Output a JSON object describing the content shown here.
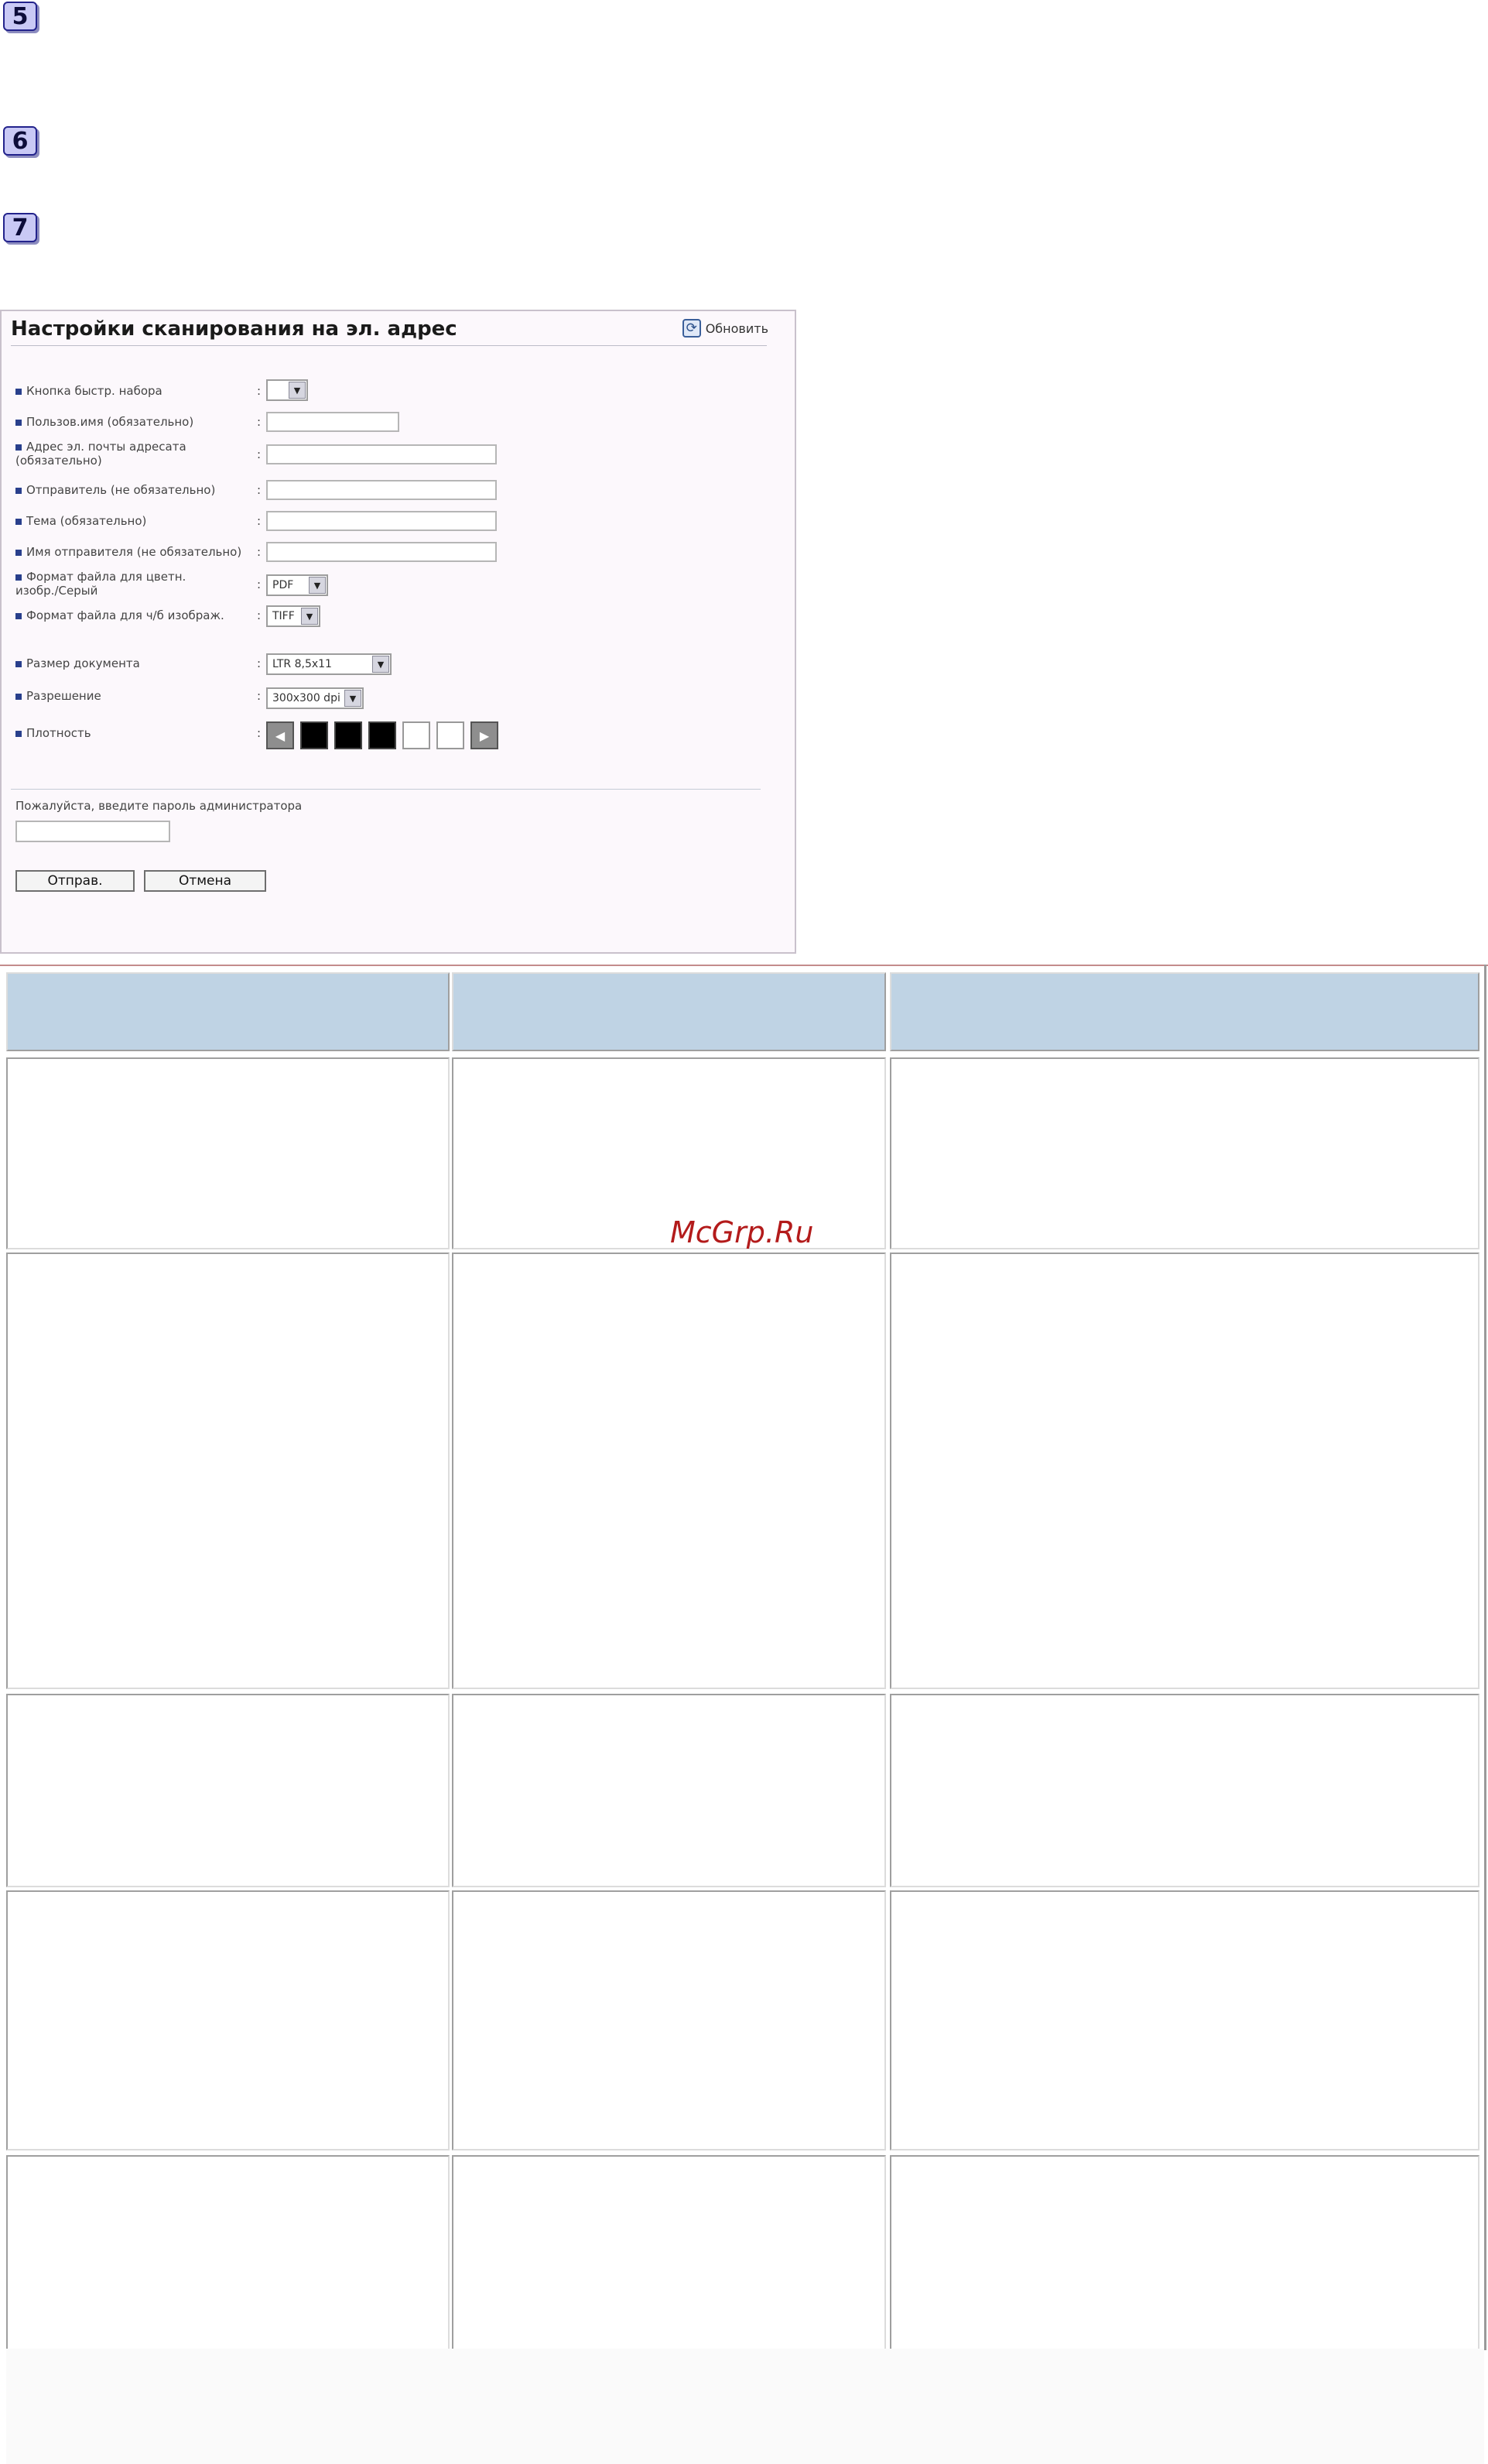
{
  "steps": [
    "5",
    "6",
    "7"
  ],
  "form": {
    "title": "Настройки сканирования на эл. адрес",
    "refresh_label": "Обновить",
    "fields": {
      "quick_dial": "Кнопка быстр. набора",
      "username": "Пользов.имя (обязательно)",
      "address_line1": "Адрес эл. почты адресата",
      "address_line2": "(обязательно)",
      "sender": "Отправитель (не обязательно)",
      "subject": "Тема (обязательно)",
      "sender_name": "Имя отправителя (не обязательно)",
      "color_format_line1": "Формат файла для цветн.",
      "color_format_line2": "изобр./Серый",
      "bw_format": "Формат файла для ч/б изображ.",
      "doc_size": "Размер документа",
      "resolution": "Разрешение",
      "density": "Плотность"
    },
    "colon": ":",
    "values": {
      "quick_dial": "",
      "color_format": "PDF",
      "bw_format": "TIFF",
      "doc_size": "LTR 8,5x11",
      "resolution": "300x300 dpi"
    },
    "density_level": {
      "dark_boxes": 3,
      "light_boxes": 2
    },
    "admin_prompt": "Пожалуйста, введите пароль администратора",
    "submit_label": "Отправ.",
    "cancel_label": "Отмена"
  },
  "watermark": "McGrp.Ru",
  "colors": {
    "header_cell": "#bfd3e4",
    "watermark": "#b31b1b",
    "step_badge": "#c9c9f5"
  }
}
